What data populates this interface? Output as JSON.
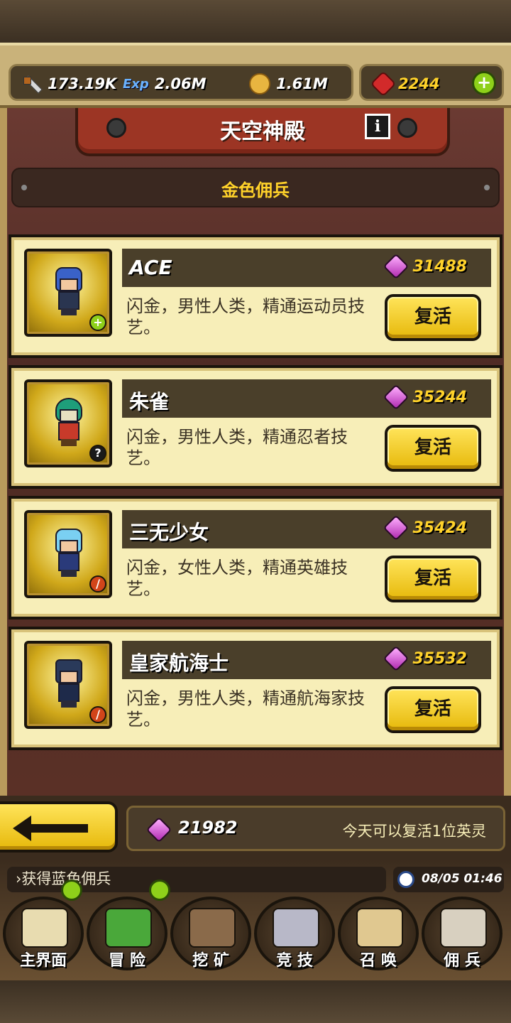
{
  "resources": {
    "attack": "173.19K",
    "exp_label": "Exp",
    "exp": "2.06M",
    "gold": "1.61M",
    "ruby": "2244",
    "add_label": "+"
  },
  "header": {
    "title": "天空神殿",
    "info_label": "i",
    "subtitle": "金色佣兵"
  },
  "heroes": [
    {
      "name": "ACE",
      "cost": "31488",
      "description": "闪金，男性人类，精通运动员技艺。",
      "button": "复活",
      "badge": "+"
    },
    {
      "name": "朱雀",
      "cost": "35244",
      "description": "闪金，男性人类，精通忍者技艺。",
      "button": "复活",
      "badge": "?"
    },
    {
      "name": "三无少女",
      "cost": "35424",
      "description": "闪金，女性人类，精通英雄技艺。",
      "button": "复活",
      "badge": "/"
    },
    {
      "name": "皇家航海士",
      "cost": "35532",
      "description": "闪金，男性人类，精通航海家技艺。",
      "button": "复活",
      "badge": "/"
    }
  ],
  "footer": {
    "gem_balance": "21982",
    "note": "今天可以复活1位英灵"
  },
  "ticker": {
    "message": "›获得蓝色佣兵",
    "time": "08/05 01:46"
  },
  "nav": [
    {
      "label": "主界面"
    },
    {
      "label": "冒 险"
    },
    {
      "label": "挖 矿"
    },
    {
      "label": "竞 技"
    },
    {
      "label": "召 唤"
    },
    {
      "label": "佣 兵"
    }
  ],
  "colors": {
    "accent_gold": "#ffd22a",
    "card_bg": "#f7eeb8",
    "button_yellow": "#e6b80a",
    "banner_red": "#9c3524",
    "notify_green": "#8ed01a"
  },
  "icons": [
    "sword-icon",
    "exp-icon",
    "coin-icon",
    "ruby-icon",
    "plus-icon",
    "info-icon",
    "gem-icon",
    "back-arrow-icon",
    "clock-icon"
  ]
}
